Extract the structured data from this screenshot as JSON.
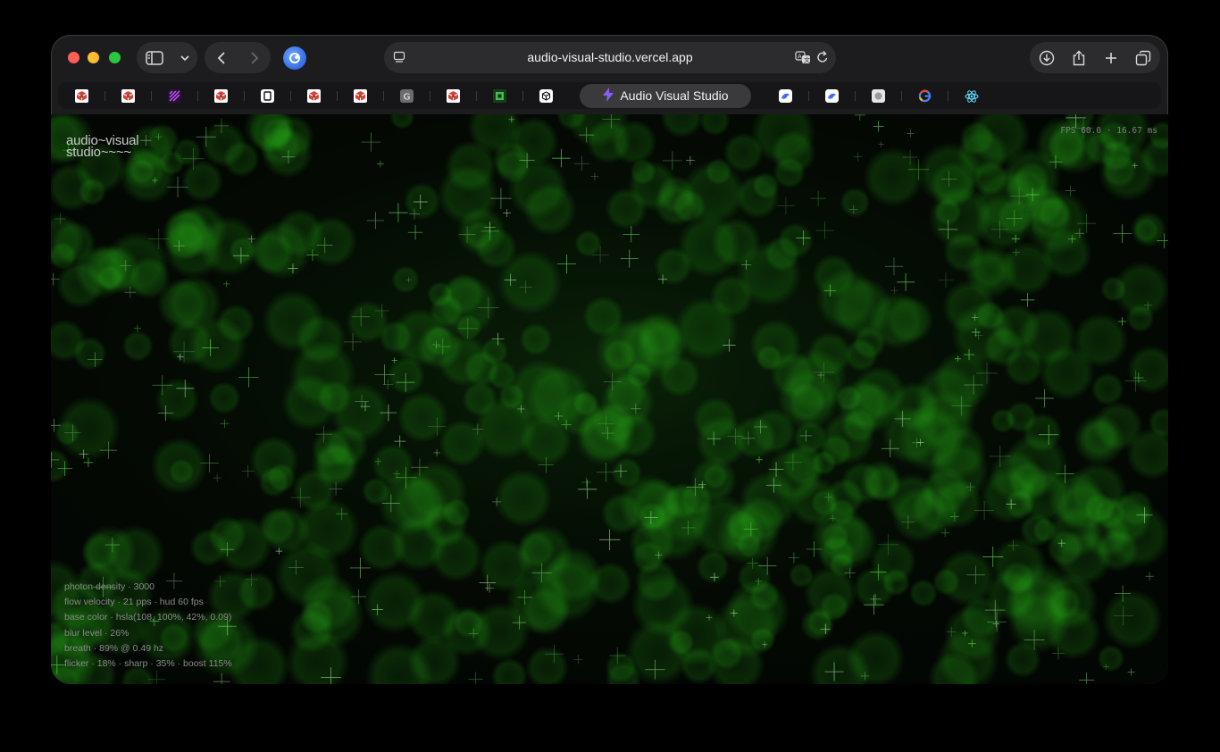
{
  "browser": {
    "url": "audio-visual-studio.vercel.app",
    "active_tab_title": "Audio Visual Studio",
    "favorites": [
      {
        "icon": "red-cube-icon",
        "color": "#e23b3b"
      },
      {
        "icon": "red-cube-icon",
        "color": "#e23b3b"
      },
      {
        "icon": "purple-stripes-icon",
        "color": "#b44bd8"
      },
      {
        "icon": "red-cube-icon",
        "color": "#e23b3b"
      },
      {
        "icon": "notebook-icon",
        "color": "#f2f2f2"
      },
      {
        "icon": "red-cube-icon",
        "color": "#e23b3b"
      },
      {
        "icon": "red-cube-icon",
        "color": "#e23b3b"
      },
      {
        "icon": "g-letter-icon",
        "color": "#8e8e93"
      },
      {
        "icon": "red-cube-icon",
        "color": "#e23b3b"
      },
      {
        "icon": "green-cube-icon",
        "color": "#3fbf4a"
      },
      {
        "icon": "cube-outline-icon",
        "color": "#f2f2f2"
      },
      {
        "icon": "dove-icon",
        "color": "#3d6bff"
      },
      {
        "icon": "dove-icon",
        "color": "#3d6bff"
      },
      {
        "icon": "github-icon",
        "color": "#d8d8d8"
      },
      {
        "icon": "google-icon",
        "color": "#4285f4"
      },
      {
        "icon": "react-icon",
        "color": "#61dafb"
      }
    ],
    "active_tab_icon": "lightning-icon",
    "active_tab_color": "#8b5cf6"
  },
  "app": {
    "logo_line1": "audio~visual",
    "logo_line2": "studio~~~~",
    "fps_readout": "FPS 60.0 · 16.67 ms",
    "hud": {
      "line1": "photon density · 3000",
      "line2": "flow velocity · 21 pps · hud 60 fps",
      "line3": "base color · hsla(108, 100%, 42%, 0.09)",
      "line4": "blur level · 26%",
      "line5": "breath · 89% @ 0.49 hz",
      "line6": "flicker · 18% · sharp · 35% · boost 115%"
    },
    "accent_color": "#2fd61a"
  }
}
